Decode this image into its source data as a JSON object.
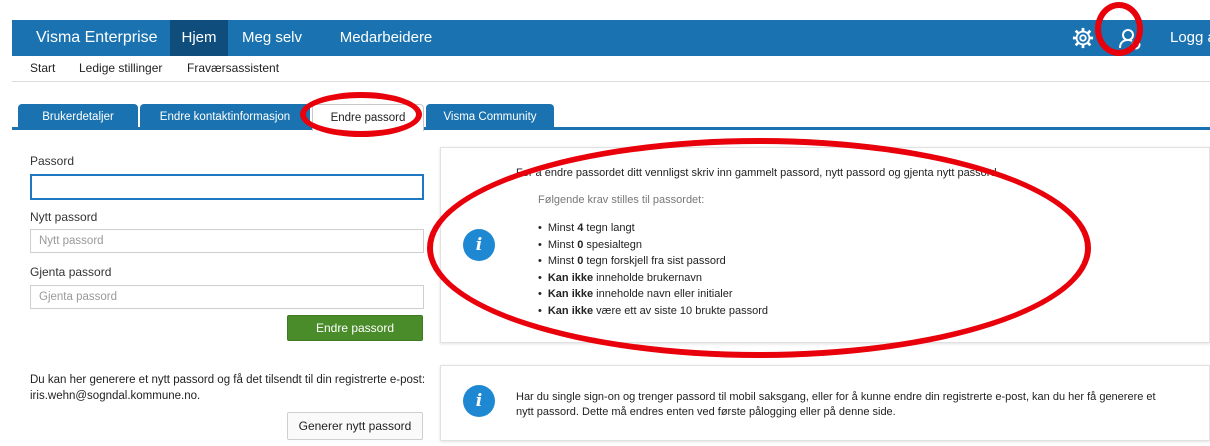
{
  "header": {
    "brand": "Visma Enterprise",
    "nav": [
      "Hjem",
      "Meg selv",
      "Medarbeidere"
    ],
    "settings_icon": "gear-icon",
    "user_icon": "user-settings-icon",
    "logout": "Logg av"
  },
  "subnav": [
    "Start",
    "Ledige stillinger",
    "Fraværsassistent"
  ],
  "tabs": [
    "Brukerdetaljer",
    "Endre kontaktinformasjon",
    "Endre passord",
    "Visma Community"
  ],
  "form": {
    "password_label": "Passord",
    "password_value": "",
    "new_password_label": "Nytt passord",
    "new_password_placeholder": "Nytt passord",
    "repeat_password_label": "Gjenta passord",
    "repeat_password_placeholder": "Gjenta passord",
    "submit": "Endre passord",
    "generate_text": "Du kan her generere et nytt passord og få det tilsendt til din registrerte e-post: iris.wehn@sogndal.kommune.no.",
    "generate_button": "Generer nytt passord"
  },
  "info": {
    "intro": "For å endre passordet ditt vennligst skriv inn gammelt passord, nytt passord og gjenta nytt passord.",
    "requirements_heading": "Følgende krav stilles til passordet:",
    "requirements": [
      {
        "bold": "",
        "pre": "Minst ",
        "num": "4",
        "post": " tegn langt"
      },
      {
        "bold": "",
        "pre": "Minst ",
        "num": "0",
        "post": " spesialtegn"
      },
      {
        "bold": "",
        "pre": "Minst ",
        "num": "0",
        "post": " tegn forskjell fra sist passord"
      },
      {
        "bold": "Kan ikke",
        "pre": "",
        "num": "",
        "post": " inneholde brukernavn"
      },
      {
        "bold": "Kan ikke",
        "pre": "",
        "num": "",
        "post": " inneholde navn eller initialer"
      },
      {
        "bold": "Kan ikke",
        "pre": "",
        "num": "",
        "post": " være ett av siste 10 brukte passord"
      }
    ],
    "sso_note": "Har du single sign-on og trenger passord til mobil saksgang, eller for å kunne endre din registrerte e-post, kan du her få generere et nytt passord. Dette må endres enten ved første pålogging eller på denne side.",
    "info_icon": "info-icon"
  },
  "colors": {
    "brand_blue": "#1a73b0",
    "active_nav": "#0f4d7c",
    "submit_green": "#4a8c2a",
    "annotation_red": "#e8000a"
  }
}
